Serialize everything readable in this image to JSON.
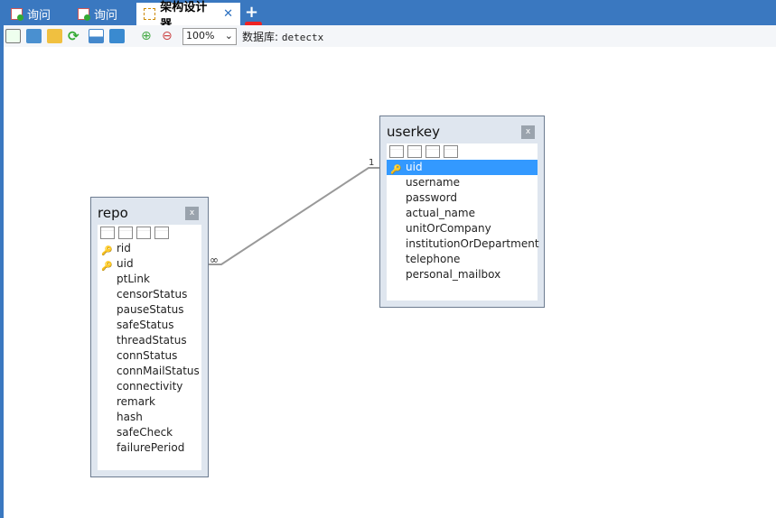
{
  "tabs": [
    {
      "label": "询问",
      "icon": "query-icon"
    },
    {
      "label": "询问",
      "icon": "query-icon"
    },
    {
      "label": "架构设计器",
      "icon": "designer-icon",
      "active": true
    }
  ],
  "new_tab": "+",
  "toolbar": {
    "zoom": "100%",
    "db_label": "数据库:",
    "db_name": "detectx",
    "buttons": [
      "new-table",
      "add-table",
      "open",
      "refresh",
      "image",
      "print",
      "zoom-in",
      "zoom-out"
    ]
  },
  "tables": {
    "repo": {
      "name": "repo",
      "close": "x",
      "fields": [
        {
          "name": "rid",
          "key": true
        },
        {
          "name": "uid",
          "key": true
        },
        {
          "name": "ptLink"
        },
        {
          "name": "censorStatus"
        },
        {
          "name": "pauseStatus"
        },
        {
          "name": "safeStatus"
        },
        {
          "name": "threadStatus"
        },
        {
          "name": "connStatus"
        },
        {
          "name": "connMailStatus"
        },
        {
          "name": "connectivity"
        },
        {
          "name": "remark"
        },
        {
          "name": "hash"
        },
        {
          "name": "safeCheck"
        },
        {
          "name": "failurePeriod"
        }
      ]
    },
    "userkey": {
      "name": "userkey",
      "close": "x",
      "fields": [
        {
          "name": "uid",
          "key": true,
          "selected": true
        },
        {
          "name": "username"
        },
        {
          "name": "password"
        },
        {
          "name": "actual_name"
        },
        {
          "name": "unitOrCompany"
        },
        {
          "name": "institutionOrDepartment"
        },
        {
          "name": "telephone"
        },
        {
          "name": "personal_mailbox"
        }
      ]
    }
  },
  "relation": {
    "many": "∞",
    "one": "1"
  }
}
